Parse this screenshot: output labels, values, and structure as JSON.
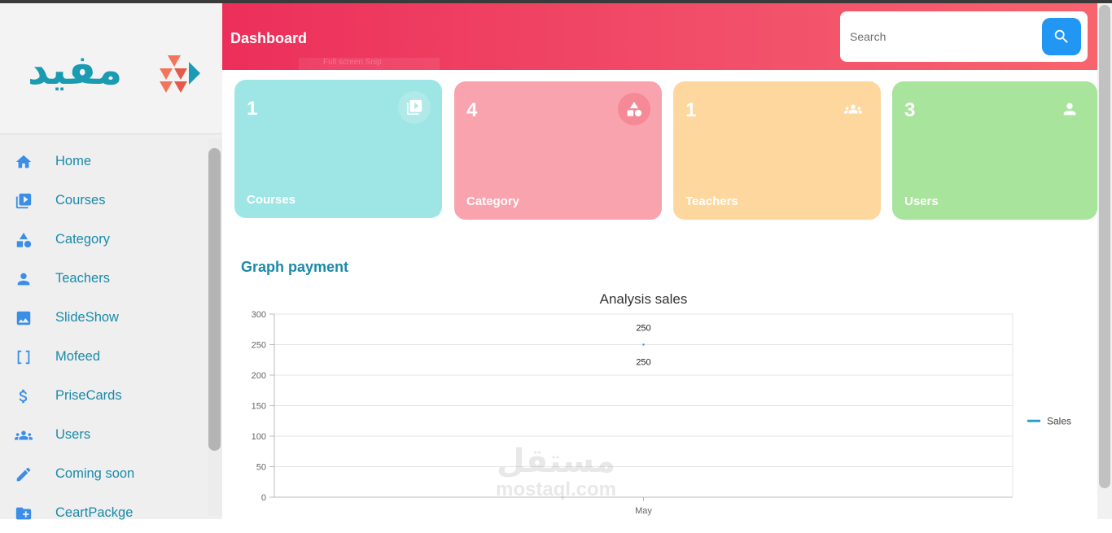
{
  "sidebar": {
    "logo_text": "مفيد",
    "items": [
      {
        "label": "Home",
        "icon": "home-icon"
      },
      {
        "label": "Courses",
        "icon": "video-library-icon"
      },
      {
        "label": "Category",
        "icon": "shapes-icon"
      },
      {
        "label": "Teachers",
        "icon": "person-icon"
      },
      {
        "label": "SlideShow",
        "icon": "image-icon"
      },
      {
        "label": "Mofeed",
        "icon": "brackets-icon"
      },
      {
        "label": "PriseCards",
        "icon": "dollar-icon"
      },
      {
        "label": "Users",
        "icon": "group-icon"
      },
      {
        "label": "Coming soon",
        "icon": "pencil-icon"
      },
      {
        "label": "CeartPackge",
        "icon": "folder-add-icon"
      }
    ]
  },
  "header": {
    "title": "Dashboard",
    "ghost_text": "Full screen Snip",
    "search_placeholder": "Search"
  },
  "cards": [
    {
      "count": "1",
      "label": "Courses",
      "color": "#9ee6e5",
      "icon": "video-library-icon"
    },
    {
      "count": "4",
      "label": "Category",
      "color": "#f8a3ad",
      "icon": "shapes-icon"
    },
    {
      "count": "1",
      "label": "Teachers",
      "color": "#fed79f",
      "icon": "group-icon"
    },
    {
      "count": "3",
      "label": "Users",
      "color": "#a8e49c",
      "icon": "person-icon"
    }
  ],
  "section_title": "Graph payment",
  "chart_data": {
    "type": "line",
    "title": "Analysis sales",
    "categories": [
      "May"
    ],
    "series": [
      {
        "name": "Sales",
        "values": [
          250
        ],
        "color": "#2a9fc9"
      }
    ],
    "ylim": [
      0,
      300
    ],
    "yticks": [
      0,
      50,
      100,
      150,
      200,
      250,
      300
    ],
    "data_labels": [
      "250",
      "250"
    ],
    "legend": "right",
    "grid": true
  },
  "watermark": {
    "arabic": "مستقل",
    "latin": "mostaql.com"
  },
  "colors": {
    "accent": "#2196f3",
    "header_start": "#ec2f5a",
    "header_end": "#f7646e",
    "text_teal": "#1a8aa8"
  }
}
